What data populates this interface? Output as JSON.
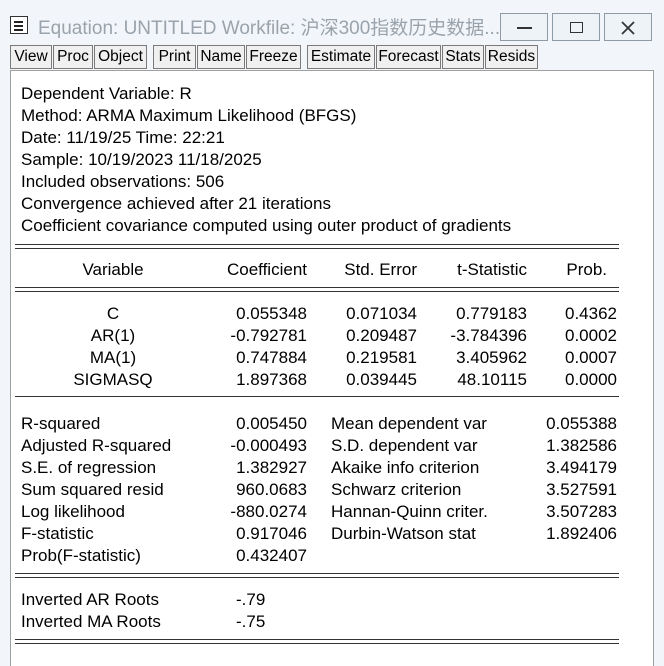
{
  "window": {
    "title": "Equation: UNTITLED   Workfile: 沪深300指数历史数据..."
  },
  "toolbar": {
    "buttons": [
      "View",
      "Proc",
      "Object",
      "Print",
      "Name",
      "Freeze",
      "Estimate",
      "Forecast",
      "Stats",
      "Resids"
    ]
  },
  "header": {
    "lines": [
      "Dependent Variable: R",
      "Method: ARMA Maximum Likelihood (BFGS)",
      "Date: 11/19/25   Time: 22:21",
      "Sample: 10/19/2023 11/18/2025",
      "Included observations: 506",
      "Convergence achieved after 21 iterations",
      "Coefficient covariance computed using outer product of gradients"
    ]
  },
  "coef_table": {
    "columns": [
      "Variable",
      "Coefficient",
      "Std. Error",
      "t-Statistic",
      "Prob."
    ],
    "rows": [
      [
        "C",
        "0.055348",
        "0.071034",
        "0.779183",
        "0.4362"
      ],
      [
        "AR(1)",
        "-0.792781",
        "0.209487",
        "-3.784396",
        "0.0002"
      ],
      [
        "MA(1)",
        "0.747884",
        "0.219581",
        "3.405962",
        "0.0007"
      ],
      [
        "SIGMASQ",
        "1.897368",
        "0.039445",
        "48.10115",
        "0.0000"
      ]
    ]
  },
  "stats": {
    "left": [
      [
        "R-squared",
        "0.005450"
      ],
      [
        "Adjusted R-squared",
        "-0.000493"
      ],
      [
        "S.E. of regression",
        "1.382927"
      ],
      [
        "Sum squared resid",
        "960.0683"
      ],
      [
        "Log likelihood",
        "-880.0274"
      ],
      [
        "F-statistic",
        "0.917046"
      ],
      [
        "Prob(F-statistic)",
        "0.432407"
      ]
    ],
    "right": [
      [
        "Mean dependent var",
        "0.055388"
      ],
      [
        "S.D. dependent var",
        "1.382586"
      ],
      [
        "Akaike info criterion",
        "3.494179"
      ],
      [
        "Schwarz criterion",
        "3.527591"
      ],
      [
        "Hannan-Quinn criter.",
        "3.507283"
      ],
      [
        "Durbin-Watson stat",
        "1.892406"
      ]
    ]
  },
  "roots": [
    [
      "Inverted AR Roots",
      "-.79"
    ],
    [
      "Inverted MA Roots",
      "-.75"
    ]
  ]
}
